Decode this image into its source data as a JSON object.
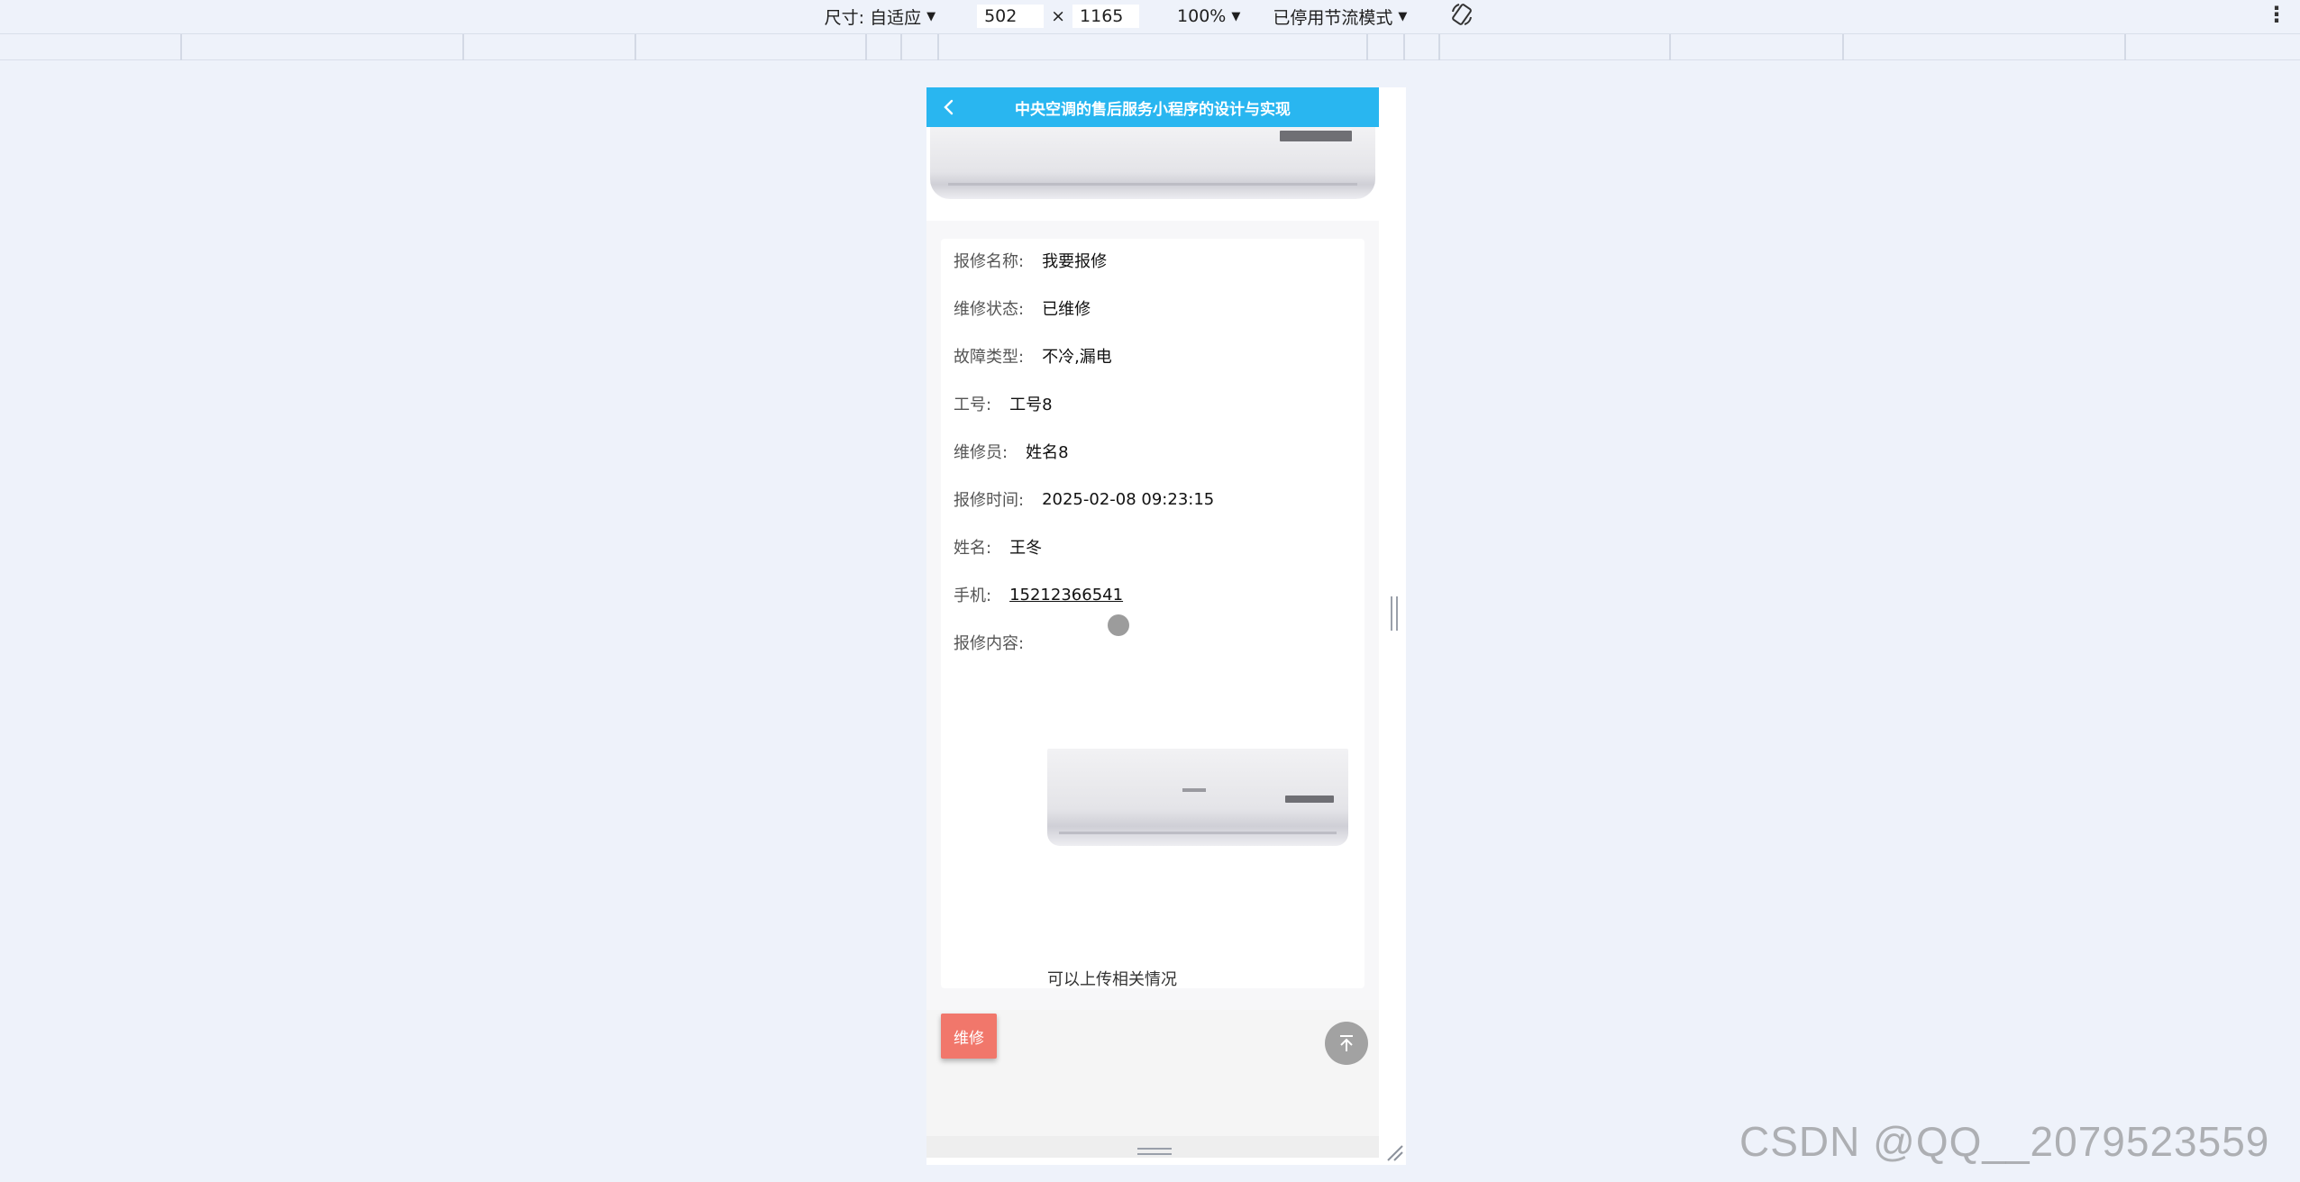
{
  "toolbar": {
    "dimensions_label": "尺寸: 自适应",
    "width": "502",
    "times": "×",
    "height": "1165",
    "zoom": "100%",
    "throttle": "已停用节流模式"
  },
  "app": {
    "title": "中央空调的售后服务小程序的设计与实现"
  },
  "detail": {
    "fields": [
      {
        "label": "报修名称:",
        "value": "我要报修"
      },
      {
        "label": "维修状态:",
        "value": "已维修"
      },
      {
        "label": "故障类型:",
        "value": "不冷,漏电"
      },
      {
        "label": "工号:",
        "value": "工号8"
      },
      {
        "label": "维修员:",
        "value": "姓名8"
      },
      {
        "label": "报修时间:",
        "value": "2025-02-08 09:23:15"
      },
      {
        "label": "姓名:",
        "value": "王冬"
      },
      {
        "label": "手机:",
        "value": "15212366541"
      }
    ],
    "content_label": "报修内容:",
    "content_text": "可以上传相关情况"
  },
  "actions": {
    "repair_label": "维修"
  },
  "watermark": "CSDN @QQ__2079523559",
  "colors": {
    "nav": "#29b6f0",
    "repair_button": "#f1776b",
    "background": "#eef2fa"
  }
}
